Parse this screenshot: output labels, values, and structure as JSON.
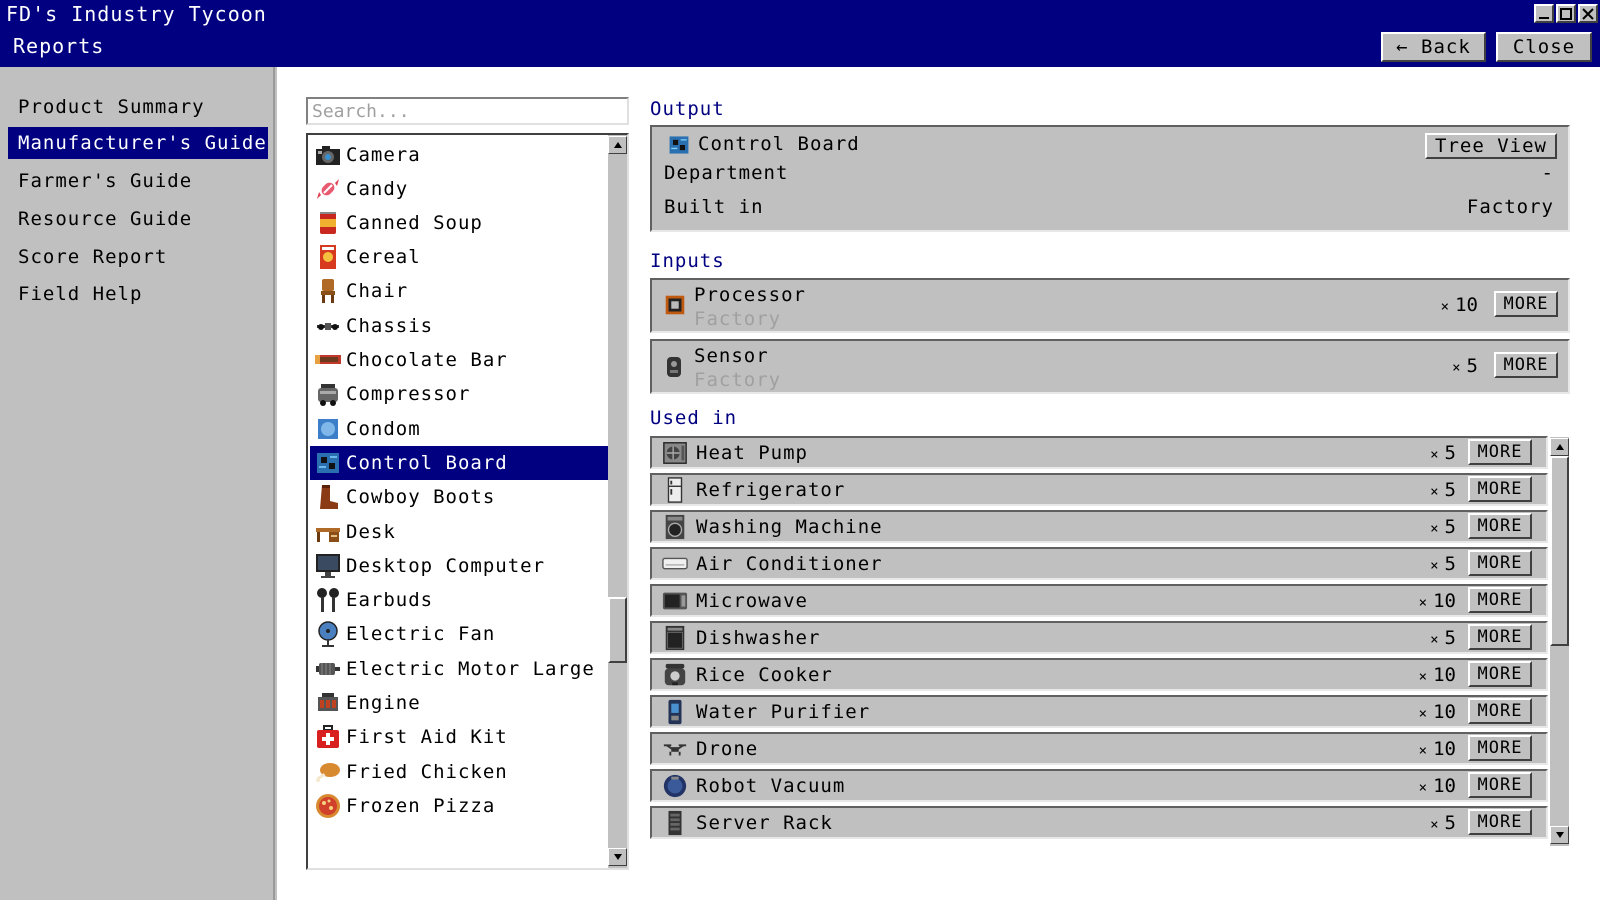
{
  "app": {
    "title": "FD's Industry Tycoon",
    "page": "Reports",
    "back_label": "← Back",
    "close_label": "Close"
  },
  "nav": [
    {
      "label": "Product Summary",
      "selected": false
    },
    {
      "label": "Manufacturer's Guide",
      "selected": true
    },
    {
      "label": "Farmer's Guide",
      "selected": false
    },
    {
      "label": "Resource Guide",
      "selected": false
    },
    {
      "label": "Score Report",
      "selected": false
    },
    {
      "label": "Field Help",
      "selected": false
    }
  ],
  "search": {
    "placeholder": "Search..."
  },
  "products": [
    {
      "label": "Camera",
      "icon": "camera-icon"
    },
    {
      "label": "Candy",
      "icon": "candy-icon"
    },
    {
      "label": "Canned Soup",
      "icon": "canned-soup-icon"
    },
    {
      "label": "Cereal",
      "icon": "cereal-icon"
    },
    {
      "label": "Chair",
      "icon": "chair-icon"
    },
    {
      "label": "Chassis",
      "icon": "chassis-icon"
    },
    {
      "label": "Chocolate Bar",
      "icon": "chocolate-bar-icon"
    },
    {
      "label": "Compressor",
      "icon": "compressor-icon"
    },
    {
      "label": "Condom",
      "icon": "condom-icon"
    },
    {
      "label": "Control Board",
      "icon": "control-board-icon",
      "selected": true
    },
    {
      "label": "Cowboy Boots",
      "icon": "cowboy-boots-icon"
    },
    {
      "label": "Desk",
      "icon": "desk-icon"
    },
    {
      "label": "Desktop Computer",
      "icon": "desktop-computer-icon"
    },
    {
      "label": "Earbuds",
      "icon": "earbuds-icon"
    },
    {
      "label": "Electric Fan",
      "icon": "electric-fan-icon"
    },
    {
      "label": "Electric Motor Large",
      "icon": "electric-motor-icon"
    },
    {
      "label": "Engine",
      "icon": "engine-icon"
    },
    {
      "label": "First Aid Kit",
      "icon": "first-aid-kit-icon"
    },
    {
      "label": "Fried Chicken",
      "icon": "fried-chicken-icon"
    },
    {
      "label": "Frozen Pizza",
      "icon": "frozen-pizza-icon"
    }
  ],
  "output": {
    "section_title": "Output",
    "name": "Control Board",
    "tree_view_label": "Tree View",
    "department_label": "Department",
    "department_value": "-",
    "built_in_label": "Built in",
    "built_in_value": "Factory"
  },
  "inputs": {
    "section_title": "Inputs",
    "items": [
      {
        "name": "Processor",
        "location": "Factory",
        "qty": "10",
        "more": "MORE"
      },
      {
        "name": "Sensor",
        "location": "Factory",
        "qty": "5",
        "more": "MORE"
      }
    ]
  },
  "used_in": {
    "section_title": "Used in",
    "x_sign": "×",
    "items": [
      {
        "name": "Heat Pump",
        "qty": "5",
        "more": "MORE"
      },
      {
        "name": "Refrigerator",
        "qty": "5",
        "more": "MORE"
      },
      {
        "name": "Washing Machine",
        "qty": "5",
        "more": "MORE"
      },
      {
        "name": "Air Conditioner",
        "qty": "5",
        "more": "MORE"
      },
      {
        "name": "Microwave",
        "qty": "10",
        "more": "MORE"
      },
      {
        "name": "Dishwasher",
        "qty": "5",
        "more": "MORE"
      },
      {
        "name": "Rice Cooker",
        "qty": "10",
        "more": "MORE"
      },
      {
        "name": "Water Purifier",
        "qty": "10",
        "more": "MORE"
      },
      {
        "name": "Drone",
        "qty": "10",
        "more": "MORE"
      },
      {
        "name": "Robot Vacuum",
        "qty": "10",
        "more": "MORE"
      },
      {
        "name": "Server Rack",
        "qty": "5",
        "more": "MORE"
      }
    ]
  },
  "colors": {
    "title_bar": "#000080",
    "selection": "#000080",
    "panel": "#c0c0c0",
    "section_title": "#000080"
  }
}
